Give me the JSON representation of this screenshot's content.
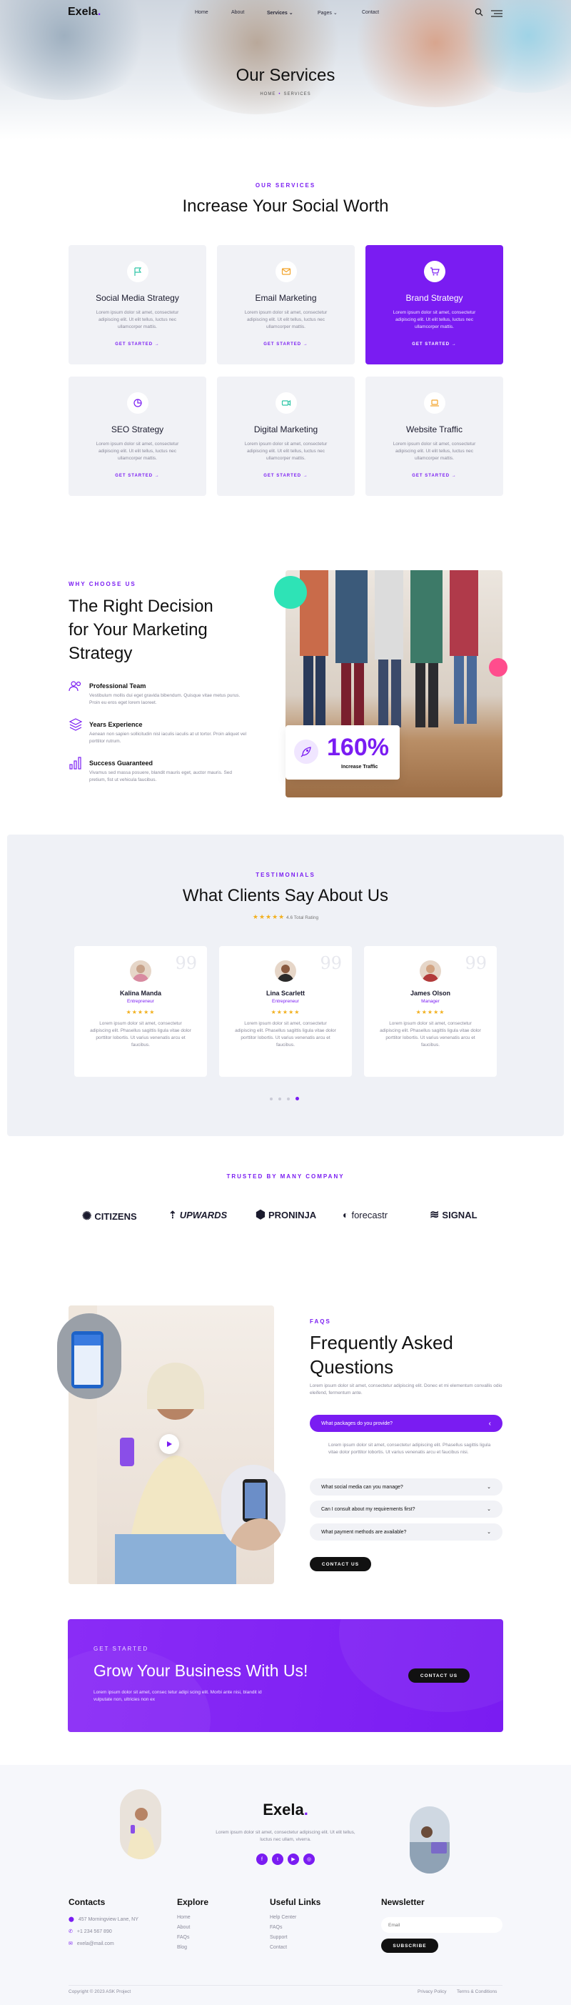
{
  "header": {
    "logo": "Exela",
    "logo_dot": ".",
    "nav": [
      "Home",
      "About",
      "Services",
      "Pages",
      "Contact"
    ],
    "services_caret": "⌄",
    "pages_caret": "⌄"
  },
  "hero": {
    "title": "Our Services",
    "breadcrumb_home": "HOME",
    "breadcrumb_sep": "•",
    "breadcrumb_current": "SERVICES"
  },
  "services": {
    "eyebrow": "OUR SERVICES",
    "title": "Increase Your Social Worth",
    "cards": [
      {
        "title": "Social Media Strategy",
        "text": "Lorem ipsum dolor sit amet, consectetur adipiscing elit. Ut elit tellus, luctus nec ullamcorper mattis.",
        "cta": "GET STARTED →",
        "icon": "flag-icon"
      },
      {
        "title": "Email Marketing",
        "text": "Lorem ipsum dolor sit amet, consectetur adipiscing elit. Ut elit tellus, luctus nec ullamcorper mattis.",
        "cta": "GET STARTED →",
        "icon": "mail-icon"
      },
      {
        "title": "Brand Strategy",
        "text": "Lorem ipsum dolor sit amet, consectetur adipiscing elit. Ut elit tellus, luctus nec ullamcorper mattis.",
        "cta": "GET STARTED →",
        "icon": "cart-icon"
      },
      {
        "title": "SEO Strategy",
        "text": "Lorem ipsum dolor sit amet, consectetur adipiscing elit. Ut elit tellus, luctus nec ullamcorper mattis.",
        "cta": "GET STARTED →",
        "icon": "pie-chart-icon"
      },
      {
        "title": "Digital Marketing",
        "text": "Lorem ipsum dolor sit amet, consectetur adipiscing elit. Ut elit tellus, luctus nec ullamcorper mattis.",
        "cta": "GET STARTED →",
        "icon": "video-icon"
      },
      {
        "title": "Website Traffic",
        "text": "Lorem ipsum dolor sit amet, consectetur adipiscing elit. Ut elit tellus, luctus nec ullamcorper mattis.",
        "cta": "GET STARTED →",
        "icon": "laptop-icon"
      }
    ]
  },
  "why": {
    "eyebrow": "WHY CHOOSE US",
    "title_line1": "The Right Decision",
    "title_line2": "for Your Marketing",
    "title_line3": "Strategy",
    "features": [
      {
        "title": "Professional Team",
        "text": "Vestibulum mollis dui eget gravida bibendum. Quisque vitae metus purus. Proin eu eros eget lorem laoreet.",
        "icon": "team-icon"
      },
      {
        "title": "Years Experience",
        "text": "Aenean non sapien sollicitudin nisl iaculis iaculis at ut tortor. Proin aliquet vel porttitor rutrum.",
        "icon": "layers-icon"
      },
      {
        "title": "Success Guaranteed",
        "text": "Vivamus sed massa posuere, blandit mauris eget, auctor mauris. Sed pretium, fist ut vehicula faucibus.",
        "icon": "bar-chart-icon"
      }
    ],
    "stat_value": "160%",
    "stat_label": "Increase Traffic"
  },
  "testimonials": {
    "eyebrow": "TESTIMONIALS",
    "title": "What Clients Say About Us",
    "stars": "★★★★★",
    "rating_text": "4.6 Total Rating",
    "items": [
      {
        "name": "Kalina Manda",
        "role": "Entrepreneur",
        "stars": "★★★★★",
        "text": "Lorem ipsum dolor sit amet, consectetur adipiscing elit. Phasellus sagittis ligula vitae dolor porttitor lobortis. Ut varius venenatis arcu et faucibus."
      },
      {
        "name": "Lina Scarlett",
        "role": "Entrepreneur",
        "stars": "★★★★★",
        "text": "Lorem ipsum dolor sit amet, consectetur adipiscing elit. Phasellus sagittis ligula vitae dolor porttitor lobortis. Ut varius venenatis arcu et faucibus."
      },
      {
        "name": "James Olson",
        "role": "Manager",
        "stars": "★★★★★",
        "text": "Lorem ipsum dolor sit amet, consectetur adipiscing elit. Phasellus sagittis ligula vitae dolor porttitor lobortis. Ut varius venenatis arcu et faucibus."
      }
    ],
    "quote_glyph": "99"
  },
  "partners": {
    "eyebrow": "TRUSTED BY MANY COMPANY",
    "logos": [
      "CITIZENS",
      "UPWARDS",
      "PRONINJA",
      "forecastr",
      "SIGNAL"
    ]
  },
  "faq": {
    "eyebrow": "FAQS",
    "title_line1": "Frequently Asked",
    "title_line2": "Questions",
    "intro": "Lorem ipsum dolor sit amet, consectetur adipiscing elit. Donec et mi elementum convallis odio eleifend, fermentum ante.",
    "items": [
      {
        "q": "What packages do you provide?",
        "icon": "‹"
      },
      {
        "q": "What social media can you manage?",
        "icon": "⌄"
      },
      {
        "q": "Can I consult about my requirements first?",
        "icon": "⌄"
      },
      {
        "q": "What payment methods are available?",
        "icon": "⌄"
      }
    ],
    "answer": "Lorem ipsum dolor sit amet, consectetur adipiscing elit. Phasellus sagittis ligula vitae dolor porttitor lobortis. Ut varius venenatis arcu et faucibus nisi.",
    "button": "CONTACT US"
  },
  "cta": {
    "eyebrow": "GET STARTED",
    "title": "Grow Your Business With Us!",
    "text_line1": "Lorem ipsum dolor sit amet, consec tetur adipi scing elit. Morbi ante nisi, blandit id",
    "text_line2": "vulputate non, ultricies non ex",
    "button": "CONTACT US"
  },
  "footer": {
    "logo": "Exela",
    "logo_dot": ".",
    "blurb_line1": "Lorem ipsum dolor sit amet, consectetur adipiscing elit. Ut elit tellus,",
    "blurb_line2": "luctus nec ullam, viverra.",
    "social": [
      "f",
      "t",
      "▶",
      "◎"
    ],
    "contacts_title": "Contacts",
    "contacts": [
      "457 Morningview Lane, NY",
      "+1 234 567 890",
      "exela@mail.com"
    ],
    "explore_title": "Explore",
    "explore": [
      "Home",
      "About",
      "FAQs",
      "Blog"
    ],
    "useful_title": "Useful Links",
    "useful": [
      "Help Center",
      "FAQs",
      "Support",
      "Contact"
    ],
    "newsletter_title": "Newsletter",
    "newsletter_placeholder": "Email",
    "subscribe": "SUBSCRIBE",
    "copyright": "Copyright © 2023 ASK Project",
    "privacy": "Privacy Policy",
    "terms": "Terms & Conditions"
  },
  "colors": {
    "accent": "#7a1cf2",
    "teal": "#2ee3b6",
    "pink": "#ff4d8d",
    "star": "#f2b01e"
  }
}
